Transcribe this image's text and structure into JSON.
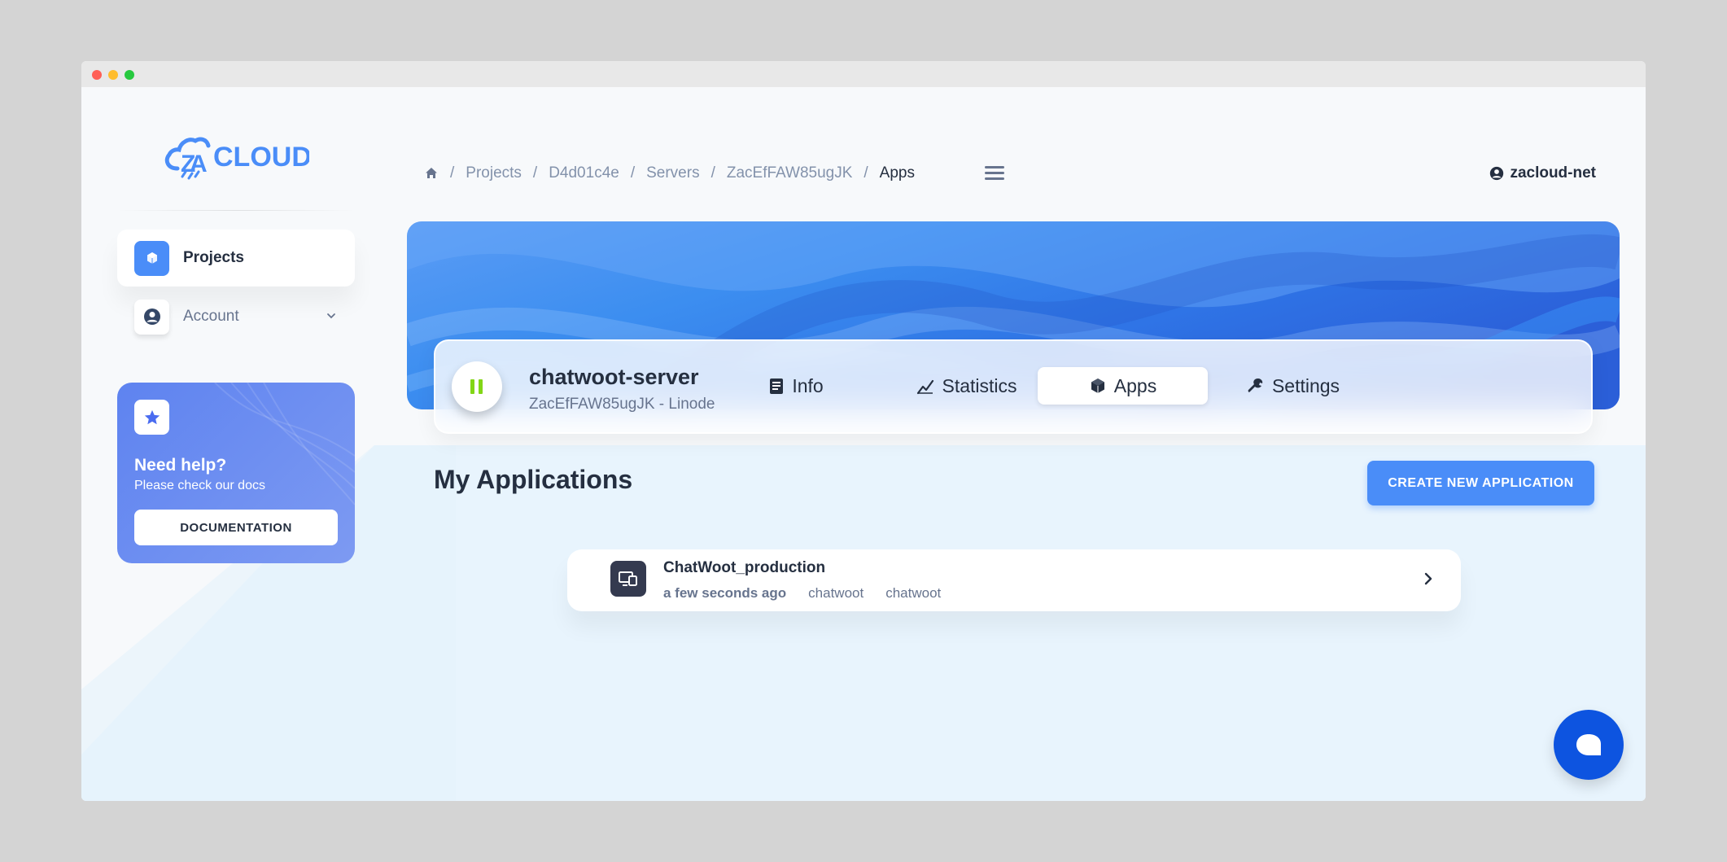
{
  "brand": {
    "logo_text": "CLOUD",
    "logo_mark": "ZA",
    "accent": "#4a8df8"
  },
  "sidebar": {
    "items": [
      {
        "label": "Projects",
        "icon": "cube-icon",
        "active": true
      },
      {
        "label": "Account",
        "icon": "user-circle-icon",
        "active": false
      }
    ],
    "help": {
      "title": "Need help?",
      "subtitle": "Please check our docs",
      "button_label": "DOCUMENTATION"
    }
  },
  "breadcrumb": {
    "items": [
      "Projects",
      "D4d01c4e",
      "Servers",
      "ZacEfFAW85ugJK"
    ],
    "current": "Apps",
    "separator": "/"
  },
  "user": {
    "name": "zacloud-net"
  },
  "server": {
    "name": "chatwoot-server",
    "subtitle": "ZacEfFAW85ugJK - Linode",
    "status_color": "#82d616"
  },
  "tabs": [
    {
      "label": "Info",
      "icon": "document-icon",
      "active": false
    },
    {
      "label": "Statistics",
      "icon": "chart-icon",
      "active": false
    },
    {
      "label": "Apps",
      "icon": "cube-icon",
      "active": true
    },
    {
      "label": "Settings",
      "icon": "wrench-icon",
      "active": false
    }
  ],
  "apps_section": {
    "title": "My Applications",
    "create_button": "CREATE NEW APPLICATION"
  },
  "applications": [
    {
      "name": "ChatWoot_production",
      "time": "a few seconds ago",
      "tags": [
        "chatwoot",
        "chatwoot"
      ]
    }
  ]
}
